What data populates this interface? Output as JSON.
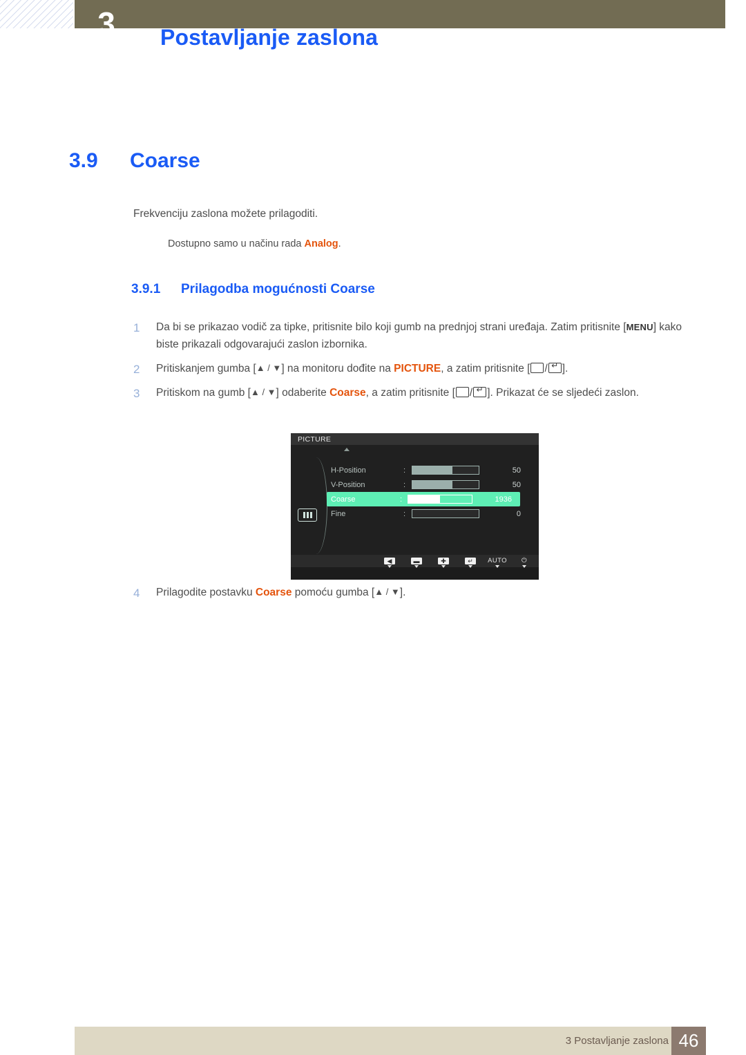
{
  "header": {
    "chapter_number": "3",
    "title": "Postavljanje zaslona",
    "band_color": "#726c53",
    "title_color": "#1a5bf5"
  },
  "section": {
    "number": "3.9",
    "title": "Coarse",
    "intro": "Frekvenciju zaslona možete prilagoditi.",
    "note_prefix": "Dostupno samo u načinu rada ",
    "note_highlight": "Analog",
    "note_suffix": "."
  },
  "subsection": {
    "number": "3.9.1",
    "title": "Prilagodba mogućnosti Coarse"
  },
  "steps": [
    {
      "n": "1",
      "part1": "Da bi se prikazao vodič za tipke, pritisnite bilo koji gumb na prednjoj strani uređaja. Zatim pritisnite [",
      "kbd": "MENU",
      "part2": "] kako biste prikazali odgovarajući zaslon izbornika."
    },
    {
      "n": "2",
      "part1": "Pritiskanjem gumba [",
      "arrows": "▲ / ▼",
      "part2": "] na monitoru dođite na ",
      "highlight": "PICTURE",
      "part3": ", a zatim pritisnite [",
      "part4": "/",
      "part5": "]."
    },
    {
      "n": "3",
      "part1": "Pritiskom na gumb [",
      "arrows": "▲ / ▼",
      "part2": "] odaberite ",
      "highlight": "Coarse",
      "part3": ", a zatim pritisnite [",
      "part4": "/",
      "part5": "]. Prikazat će se sljedeći zaslon."
    },
    {
      "n": "4",
      "part1": "Prilagodite postavku ",
      "highlight": "Coarse",
      "part2": " pomoću gumba [",
      "arrows": "▲ / ▼",
      "part3": "]."
    }
  ],
  "osd": {
    "title": "PICTURE",
    "highlight_color": "#5eefb5",
    "rows": [
      {
        "label": "H-Position",
        "colon": ":",
        "value": "50",
        "fill_percent": 60,
        "active": false
      },
      {
        "label": "V-Position",
        "colon": ":",
        "value": "50",
        "fill_percent": 60,
        "active": false
      },
      {
        "label": "Coarse",
        "colon": ":",
        "value": "1936",
        "fill_percent": 50,
        "active": true
      },
      {
        "label": "Fine",
        "colon": ":",
        "value": "0",
        "fill_percent": 0,
        "active": false
      }
    ],
    "footer_buttons": [
      {
        "name": "back",
        "glyph": "◀"
      },
      {
        "name": "minus",
        "glyph": "▬"
      },
      {
        "name": "plus",
        "glyph": "✚"
      },
      {
        "name": "enter",
        "glyph": "↵"
      },
      {
        "name": "auto",
        "glyph": "AUTO"
      },
      {
        "name": "power",
        "glyph": "⏻"
      }
    ]
  },
  "footer": {
    "chapter_label": "3 Postavljanje zaslona",
    "page_number": "46",
    "band_color": "#ded8c4",
    "page_box_color": "#8c7a6f"
  }
}
